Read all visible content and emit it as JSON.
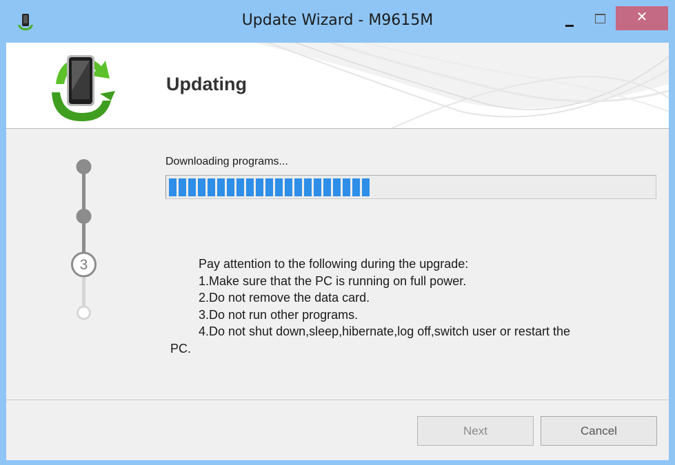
{
  "window": {
    "title": "Update Wizard - M9615M",
    "close_glyph": "✕",
    "accent_color": "#8fc5f5",
    "close_color": "#c56a84"
  },
  "header": {
    "title": "Updating",
    "logo_icon": "phone-update-icon"
  },
  "steps": {
    "current_step": "3",
    "completed_color": "#8c8c8c",
    "pending_color": "#d6d6d6"
  },
  "progress": {
    "status": "Downloading programs...",
    "fraction": 0.41,
    "color": "#2e8ee8"
  },
  "notice": {
    "lines": [
      "Pay attention to the following during the upgrade:",
      "1.Make sure that the PC is running on full power.",
      "2.Do not remove the data card.",
      "3.Do not run other programs.",
      "4.Do not shut down,sleep,hibernate,log off,switch user or restart the",
      "PC."
    ]
  },
  "buttons": {
    "next": "Next",
    "cancel": "Cancel"
  }
}
